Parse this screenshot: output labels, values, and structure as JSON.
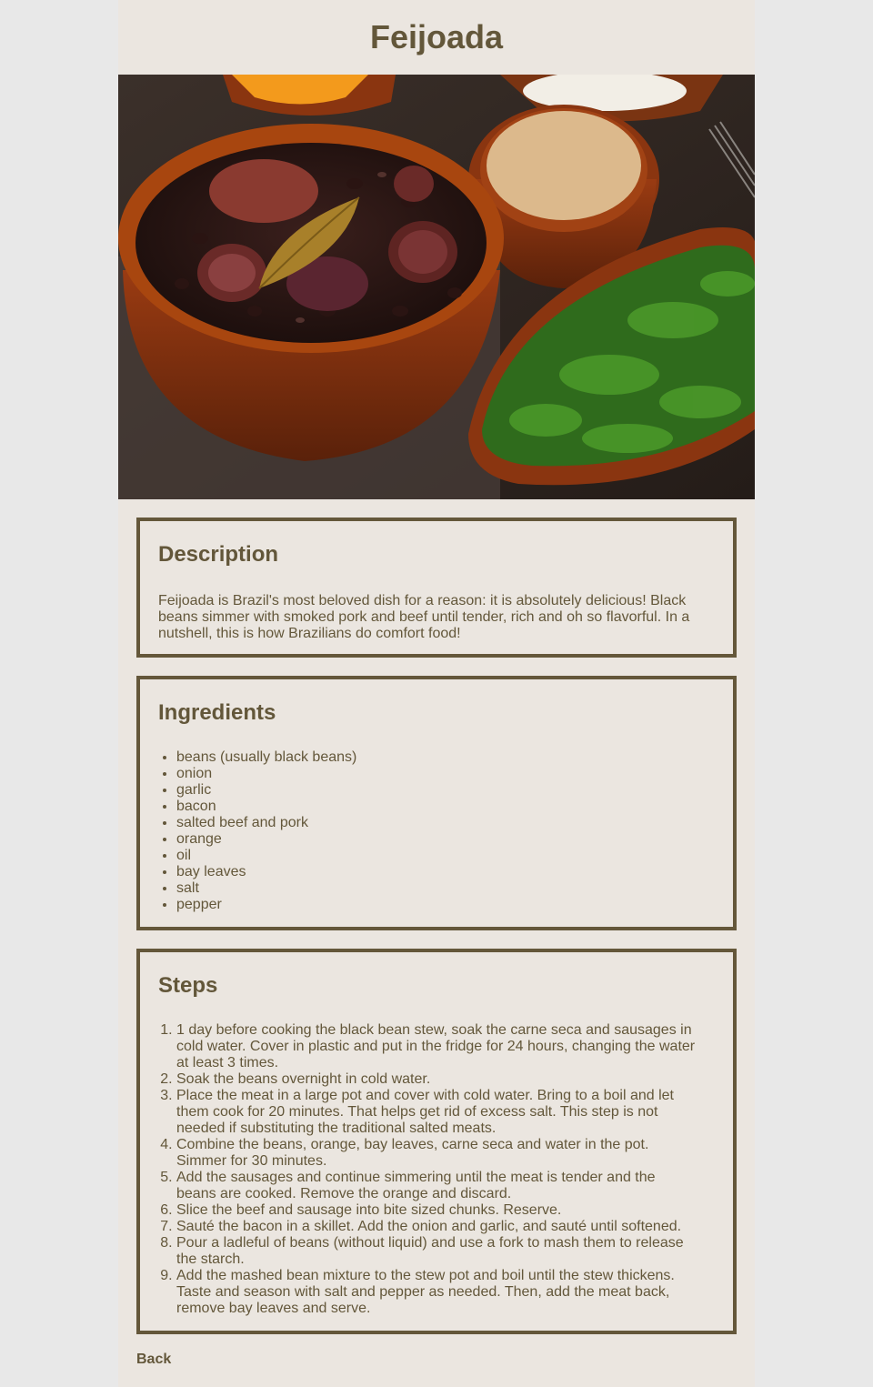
{
  "title": "Feijoada",
  "description": {
    "heading": "Description",
    "text": "Feijoada is Brazil's most beloved dish for a reason: it is absolutely delicious! Black beans simmer with smoked pork and beef until tender, rich and oh so flavorful. In a nutshell, this is how Brazilians do comfort food!"
  },
  "ingredients": {
    "heading": "Ingredients",
    "items": [
      "beans (usually black beans)",
      "onion",
      "garlic",
      "bacon",
      "salted beef and pork",
      "orange",
      "oil",
      "bay leaves",
      "salt",
      "pepper"
    ]
  },
  "steps": {
    "heading": "Steps",
    "items": [
      "1 day before cooking the black bean stew, soak the carne seca and sausages in cold water. Cover in plastic and put in the fridge for 24 hours, changing the water at least 3 times.",
      "Soak the beans overnight in cold water.",
      "Place the meat in a large pot and cover with cold water. Bring to a boil and let them cook for 20 minutes. That helps get rid of excess salt. This step is not needed if substituting the traditional salted meats.",
      "Combine the beans, orange, bay leaves, carne seca and water in the pot. Simmer for 30 minutes.",
      "Add the sausages and continue simmering until the meat is tender and the beans are cooked. Remove the orange and discard.",
      "Slice the beef and sausage into bite sized chunks. Reserve.",
      "Sauté the bacon in a skillet. Add the onion and garlic, and sauté until softened.",
      "Pour a ladleful of beans (without liquid) and use a fork to mash them to release the starch.",
      "Add the mashed bean mixture to the stew pot and boil until the stew thickens. Taste and season with salt and pepper as needed. Then, add the meat back, remove bay leaves and serve."
    ]
  },
  "back_label": "Back",
  "colors": {
    "text": "#63573a",
    "border": "#64573a",
    "panel": "#ebe6e0",
    "page_bg": "#e8e8e8"
  }
}
